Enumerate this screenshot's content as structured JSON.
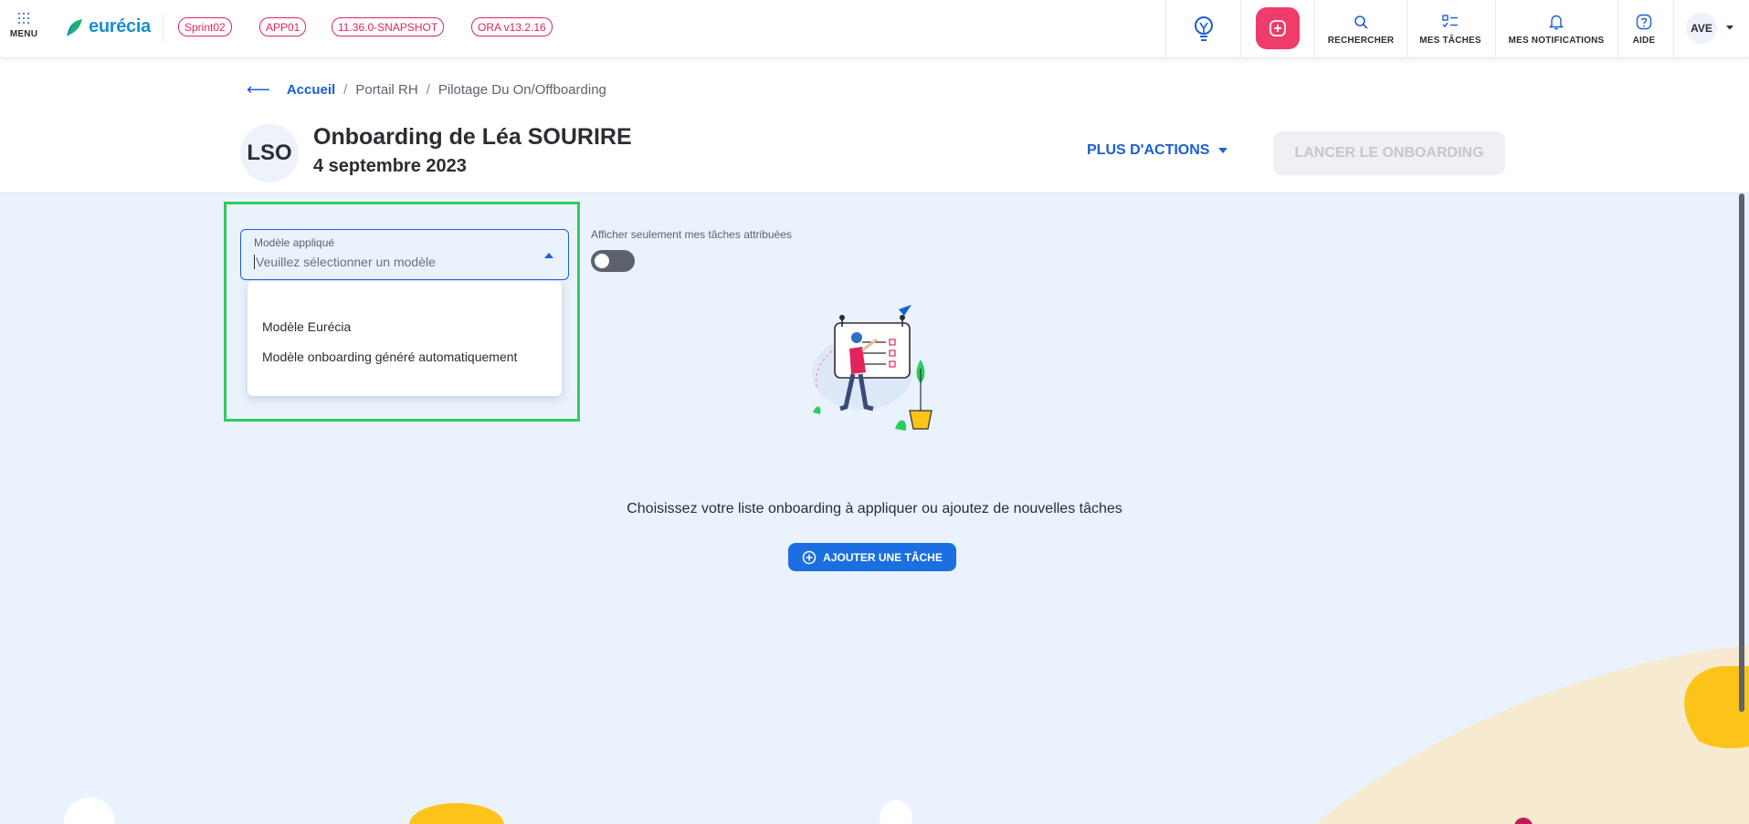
{
  "topbar": {
    "menu_label": "MENU",
    "brand": "eurécia",
    "env_badges": [
      "Sprint02",
      "APP01",
      "11.36.0-SNAPSHOT",
      "ORA v13.2.16"
    ],
    "search_label": "RECHERCHER",
    "tasks_label": "MES TÂCHES",
    "notifications_label": "MES NOTIFICATIONS",
    "help_label": "AIDE",
    "user_initials": "AVE"
  },
  "header": {
    "breadcrumb": {
      "home": "Accueil",
      "level2": "Portail RH",
      "level3": "Pilotage Du On/Offboarding"
    },
    "initials": "LSO",
    "title": "Onboarding de Léa SOURIRE",
    "subtitle": "4 septembre 2023",
    "more_actions_label": "PLUS D'ACTIONS",
    "launch_label": "LANCER LE ONBOARDING"
  },
  "main": {
    "template_select": {
      "label": "Modèle appliqué",
      "placeholder": "Veuillez sélectionner un modèle",
      "options": [
        "Modèle Eurécia",
        "Modèle onboarding généré automatiquement"
      ]
    },
    "toggle_label": "Afficher seulement mes tâches attribuées",
    "empty_message": "Choisissez votre liste onboarding à appliquer ou ajoutez de nouvelles tâches",
    "add_task_label": "AJOUTER UNE TÂCHE"
  },
  "colors": {
    "primary": "#1b5fd1",
    "accent_pink": "#f03c6a",
    "badge_red": "#e0245e",
    "focus_green": "#2ecc5f",
    "main_bg": "#eaf2fd"
  }
}
